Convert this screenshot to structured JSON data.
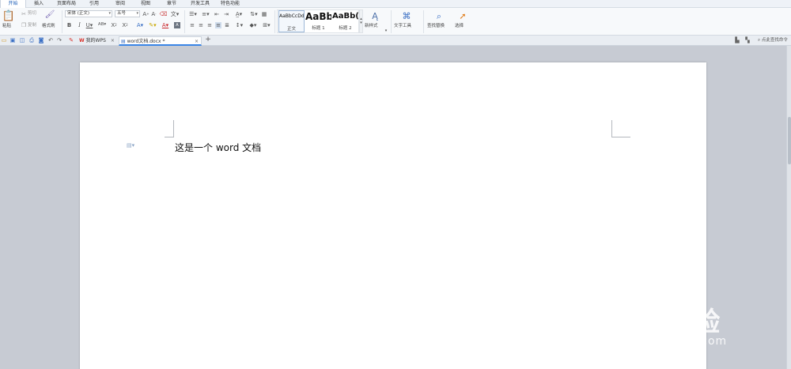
{
  "menu_tabs": [
    "开始",
    "插入",
    "页面布局",
    "引用",
    "审阅",
    "视图",
    "章节",
    "开发工具",
    "特色功能"
  ],
  "clipboard": {
    "paste": "粘贴",
    "cut": "剪切",
    "copy": "复制",
    "format_painter": "格式刷"
  },
  "font": {
    "name": "宋体 (正文)",
    "size": "五号"
  },
  "styles": [
    {
      "sample": "AaBbCcDd",
      "name": "正文"
    },
    {
      "sample": "AaBb",
      "name": "标题 1"
    },
    {
      "sample": "AaBb(",
      "name": "标题 2"
    }
  ],
  "tools": {
    "new_style": "新样式",
    "text_tools": "文字工具",
    "find_replace": "查找替换",
    "select": "选择"
  },
  "doc_tabs": {
    "my_wps": "我的WPS",
    "current": "word文档.docx *",
    "new_tab": "+"
  },
  "search_hint": "点此查找命令",
  "document": {
    "text": "这是一个 word 文档"
  },
  "watermark": {
    "brand": "Bai 经验",
    "url": "jingyan.baidu.com"
  },
  "colors": {
    "accent": "#1f5fb8",
    "tab_underline": "#3a86e6",
    "workspace": "#c7cbd3",
    "wps_red": "#d9332b"
  }
}
